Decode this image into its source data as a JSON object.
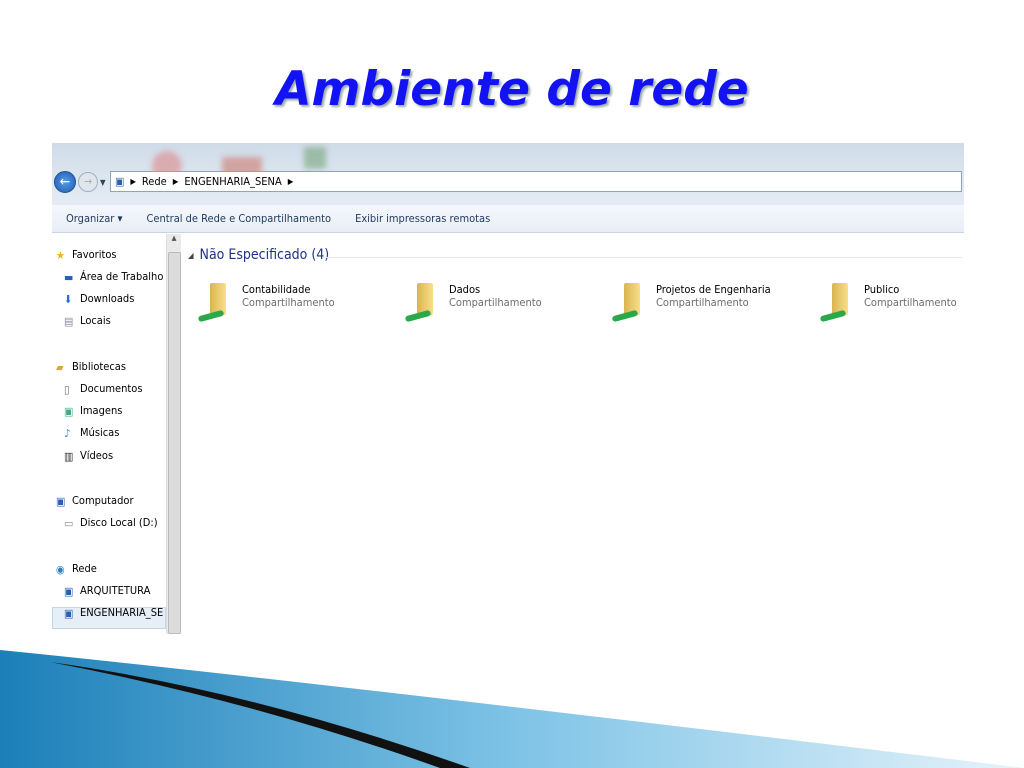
{
  "slide": {
    "title": "Ambiente de rede"
  },
  "address": {
    "crumbs": [
      "Rede",
      "ENGENHARIA_SENA"
    ]
  },
  "toolbar": {
    "organize": "Organizar ▾",
    "network_center": "Central de Rede e Compartilhamento",
    "printers": "Exibir impressoras remotas"
  },
  "sidebar": {
    "items": [
      {
        "label": "Favoritos",
        "icon": "star-icon"
      },
      {
        "label": "Área de Trabalho",
        "icon": "desktop-icon"
      },
      {
        "label": "Downloads",
        "icon": "downloads-icon"
      },
      {
        "label": "Locais",
        "icon": "recent-places-icon"
      },
      {
        "label": "Bibliotecas",
        "icon": "libraries-icon"
      },
      {
        "label": "Documentos",
        "icon": "documents-icon"
      },
      {
        "label": "Imagens",
        "icon": "images-icon"
      },
      {
        "label": "Músicas",
        "icon": "music-icon"
      },
      {
        "label": "Vídeos",
        "icon": "videos-icon"
      },
      {
        "label": "Computador",
        "icon": "computer-icon"
      },
      {
        "label": "Disco Local (D:)",
        "icon": "drive-icon"
      },
      {
        "label": "Rede",
        "icon": "network-icon"
      },
      {
        "label": "ARQUITETURA",
        "icon": "computer-icon"
      },
      {
        "label": "ENGENHARIA_SE",
        "icon": "computer-icon"
      }
    ]
  },
  "group": {
    "label": "Não Especificado (4)"
  },
  "items": [
    {
      "name": "Contabilidade",
      "type": "Compartilhamento"
    },
    {
      "name": "Dados",
      "type": "Compartilhamento"
    },
    {
      "name": "Projetos de Engenharia",
      "type": "Compartilhamento"
    },
    {
      "name": "Publico",
      "type": "Compartilhamento"
    }
  ]
}
